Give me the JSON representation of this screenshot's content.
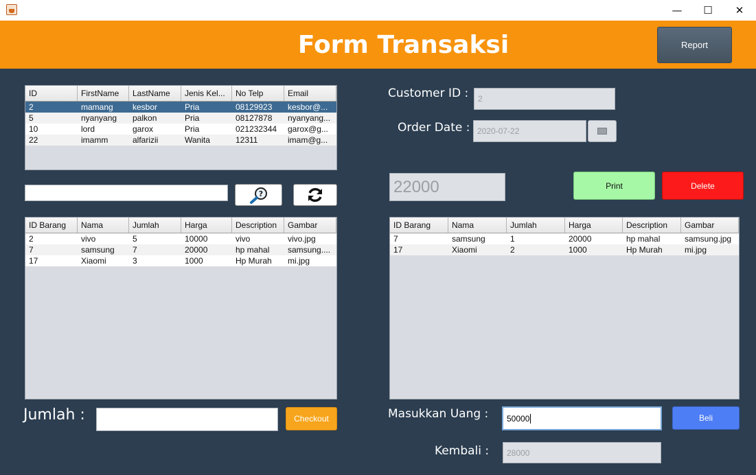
{
  "window": {
    "app_icon": "java-cup-icon",
    "min_glyph": "—",
    "max_glyph": "☐",
    "close_glyph": "✕"
  },
  "header": {
    "title": "Form Transaksi",
    "report_label": "Report",
    "accent": "#f7930d"
  },
  "customers": {
    "columns": [
      "ID",
      "FirstName",
      "LastName",
      "Jenis Kel...",
      "No Telp",
      "Email"
    ],
    "rows": [
      [
        "2",
        "mamang",
        "kesbor",
        "Pria",
        "08129923",
        "kesbor@..."
      ],
      [
        "5",
        "nyanyang",
        "palkon",
        "Pria",
        "08127878",
        "nyanyang..."
      ],
      [
        "10",
        "lord",
        "garox",
        "Pria",
        "021232344",
        "garox@g..."
      ],
      [
        "22",
        "imamm",
        "alfarizii",
        "Wanita",
        "12311",
        "imam@g..."
      ]
    ],
    "selected_row": 0
  },
  "search": {
    "value": "",
    "search_icon": "magnifier-question-icon",
    "refresh_icon": "refresh-icon"
  },
  "products": {
    "columns": [
      "ID Barang",
      "Nama",
      "Jumlah",
      "Harga",
      "Description",
      "Gambar"
    ],
    "rows": [
      [
        "2",
        "vivo",
        "5",
        "10000",
        "vivo",
        "vivo.jpg"
      ],
      [
        "7",
        "samsung",
        "7",
        "20000",
        "hp mahal",
        "samsung...."
      ],
      [
        "17",
        "Xiaomi",
        "3",
        "1000",
        "Hp Murah",
        "mi.jpg"
      ]
    ]
  },
  "jumlah": {
    "label": "Jumlah :",
    "value": "",
    "checkout_label": "Checkout"
  },
  "customer_id": {
    "label": "Customer ID :",
    "value": "2"
  },
  "order_date": {
    "label": "Order Date :",
    "value": "2020-07-22",
    "calendar_icon": "calendar-icon"
  },
  "total": {
    "value": "22000"
  },
  "actions": {
    "print_label": "Print",
    "delete_label": "Delete",
    "print_color": "#a6f7a6",
    "delete_color": "#fd1a1a"
  },
  "cart": {
    "columns": [
      "ID Barang",
      "Nama",
      "Jumlah",
      "Harga",
      "Description",
      "Gambar"
    ],
    "rows": [
      [
        "7",
        "samsung",
        "1",
        "20000",
        "hp mahal",
        "samsung.jpg"
      ],
      [
        "17",
        "Xiaomi",
        "2",
        "1000",
        "Hp Murah",
        "mi.jpg"
      ]
    ]
  },
  "payment": {
    "label": "Masukkan Uang :",
    "value": "50000",
    "beli_label": "Beli",
    "beli_color": "#4e7ef5"
  },
  "change": {
    "label": "Kembali :",
    "value": "28000"
  }
}
